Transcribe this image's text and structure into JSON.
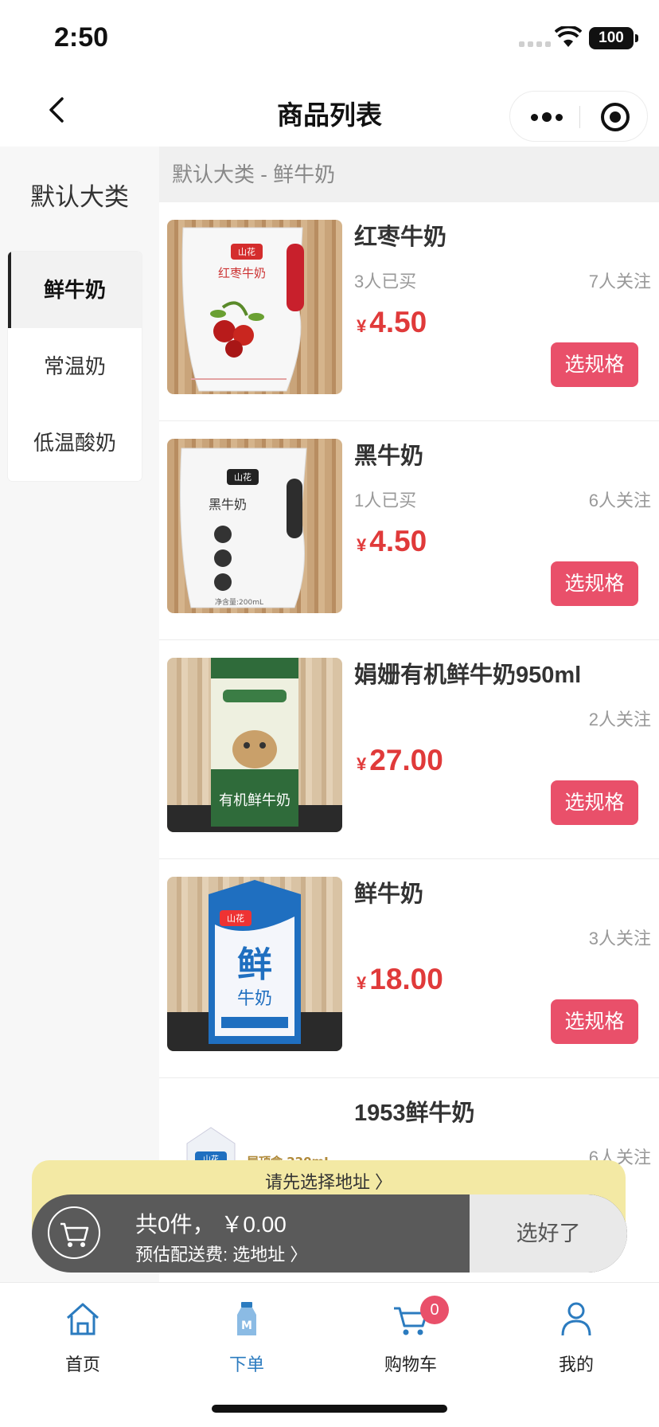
{
  "status_bar": {
    "time": "2:50",
    "battery": "100"
  },
  "nav": {
    "title": "商品列表"
  },
  "sidebar": {
    "main_category": "默认大类",
    "items": [
      {
        "label": "鲜牛奶",
        "active": true
      },
      {
        "label": "常温奶",
        "active": false
      },
      {
        "label": "低温酸奶",
        "active": false
      }
    ]
  },
  "breadcrumb": "默认大类 - 鲜牛奶",
  "products": [
    {
      "name": "红枣牛奶",
      "sold": "3人已买",
      "watch": "7人关注",
      "currency": "¥",
      "price": "4.50",
      "button": "选规格",
      "image": "red-date-milk-pouch"
    },
    {
      "name": "黑牛奶",
      "sold": "1人已买",
      "watch": "6人关注",
      "currency": "¥",
      "price": "4.50",
      "button": "选规格",
      "image": "black-milk-pouch"
    },
    {
      "name": "娟姗有机鲜牛奶950ml",
      "sold": "",
      "watch": "2人关注",
      "currency": "¥",
      "price": "27.00",
      "button": "选规格",
      "image": "jersey-organic-milk-carton"
    },
    {
      "name": "鲜牛奶",
      "sold": "",
      "watch": "3人关注",
      "currency": "¥",
      "price": "18.00",
      "button": "选规格",
      "image": "fresh-milk-carton"
    },
    {
      "name": "1953鲜牛奶",
      "sold": "",
      "watch": "6人关注",
      "currency": "¥",
      "price": "",
      "button": "",
      "image": "1953-fresh-milk",
      "image_text": "屋顶盒 220mL"
    }
  ],
  "cart": {
    "address_tip": "请先选择地址 〉",
    "summary": "共0件， ￥0.00",
    "delivery": "预估配送费: 选地址 〉",
    "done_button": "选好了"
  },
  "tabbar": [
    {
      "label": "首页",
      "icon": "home-icon"
    },
    {
      "label": "下单",
      "icon": "milk-bottle-icon",
      "active": true
    },
    {
      "label": "购物车",
      "icon": "cart-icon",
      "badge": "0"
    },
    {
      "label": "我的",
      "icon": "user-icon"
    }
  ],
  "colors": {
    "accent": "#e9506a",
    "price": "#e03a3a",
    "active_tab": "#2b7bbf"
  }
}
